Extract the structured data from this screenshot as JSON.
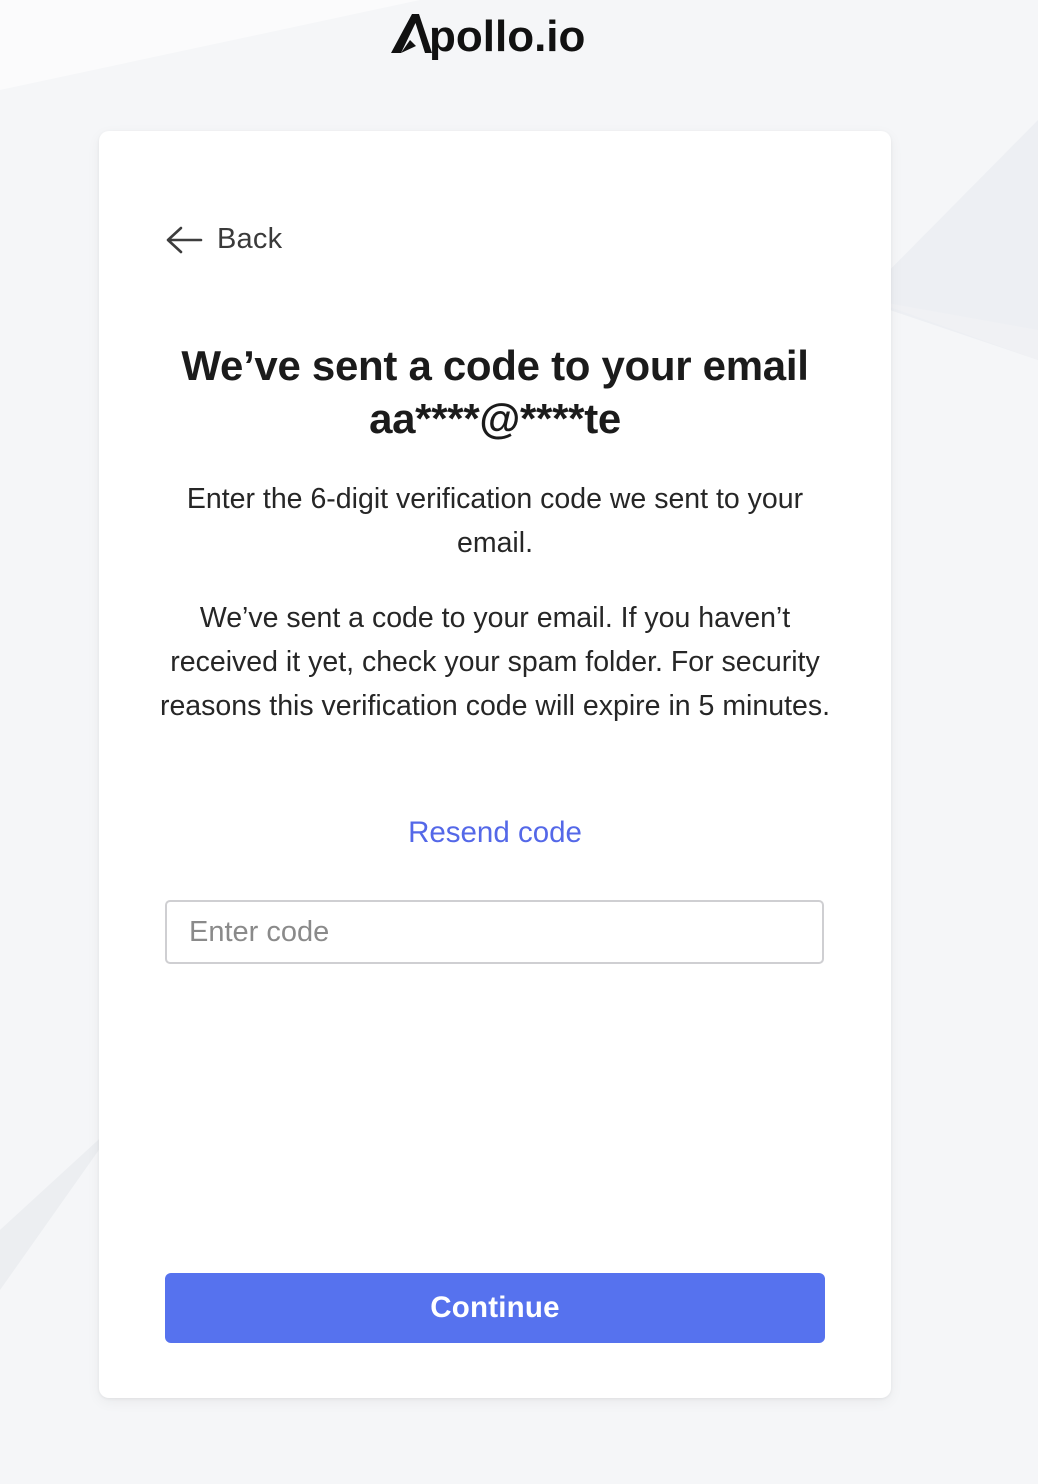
{
  "brand": {
    "name": "Apollo.io",
    "icon": "apollo-logo-icon"
  },
  "card": {
    "back_label": "Back",
    "back_icon": "arrow-left-icon",
    "heading_line1": "We’ve sent a code to your email",
    "heading_line2": "aa****@****te",
    "instruction": "Enter the 6-digit verification code we sent to your email.",
    "notice": "We’ve sent a code to your email. If you haven’t received it yet, check your spam folder. For security reasons this verification code will expire in 5 minutes.",
    "resend_label": "Resend code",
    "code_input": {
      "placeholder": "Enter code",
      "value": ""
    },
    "continue_label": "Continue"
  },
  "colors": {
    "accent": "#5672ee",
    "link": "#5468e8",
    "background": "#f5f6f8",
    "card": "#ffffff"
  }
}
